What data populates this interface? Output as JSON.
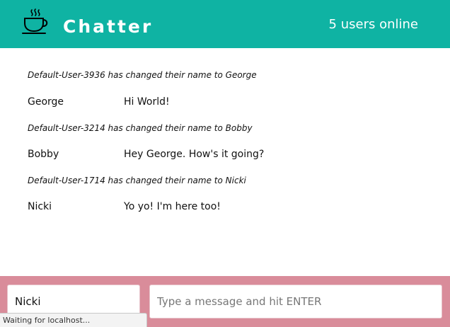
{
  "navbar": {
    "brand": "Chatter",
    "logo_icon": "coffee-cup-icon",
    "users_online": "5 users online",
    "color": "#0fb3a3"
  },
  "messages": [
    {
      "type": "notification",
      "text": "Default-User-3936 has changed their name to George"
    },
    {
      "type": "message",
      "username": "George",
      "content": "Hi World!"
    },
    {
      "type": "notification",
      "text": "Default-User-3214 has changed their name to Bobby"
    },
    {
      "type": "message",
      "username": "Bobby",
      "content": "Hey George. How's it going?"
    },
    {
      "type": "notification",
      "text": "Default-User-1714 has changed their name to Nicki"
    },
    {
      "type": "message",
      "username": "Nicki",
      "content": "Yo yo! I'm here too!"
    }
  ],
  "footer": {
    "username_value": "Nicki",
    "message_placeholder": "Type a message and hit ENTER",
    "color": "#d98c9a"
  },
  "status_bar": {
    "text": "Waiting for localhost..."
  }
}
